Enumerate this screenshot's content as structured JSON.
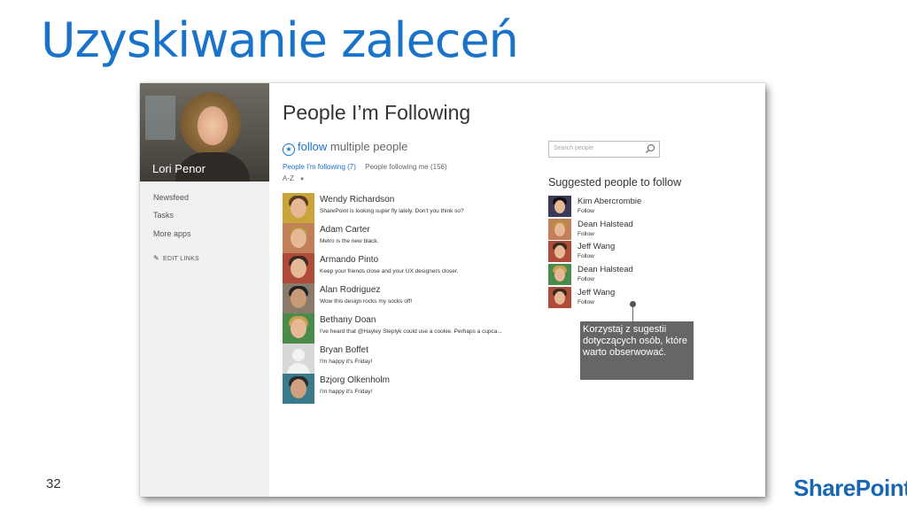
{
  "slide": {
    "title": "Uzyskiwanie zaleceń",
    "page_number": "32",
    "brand": "SharePoint"
  },
  "profile": {
    "name": "Lori Penor"
  },
  "nav": {
    "items": [
      "Newsfeed",
      "Tasks",
      "More apps"
    ],
    "edit_links": "EDIT LINKS"
  },
  "main": {
    "heading": "People I’m Following",
    "follow_word": "follow",
    "follow_rest": " multiple people",
    "tabs": [
      {
        "label": "People I'm following (7)",
        "active": true
      },
      {
        "label": "People following me (156)",
        "active": false
      }
    ],
    "sort_label": "A-Z",
    "people": [
      {
        "name": "Wendy Richardson",
        "status": "SharePoint is looking super fly lately.  Don't you think so?"
      },
      {
        "name": "Adam Carter",
        "status": "Metro is the new black."
      },
      {
        "name": "Armando Pinto",
        "status": "Keep your friends close and your UX designers closer."
      },
      {
        "name": "Alan Rodriguez",
        "status": "Wow this design rocks my socks off!"
      },
      {
        "name": "Bethany Doan",
        "status": "I've heard that @Hayley Steplyk could use a cookie.  Perhaps a cupca..."
      },
      {
        "name": "Bryan Boffet",
        "status": "I'm happy it's Friday!"
      },
      {
        "name": "Bzjorg Olkenholm",
        "status": "I'm happy it's Friday!"
      }
    ]
  },
  "search": {
    "placeholder": "Search people"
  },
  "suggested": {
    "heading": "Suggested people to follow",
    "people": [
      {
        "name": "Kim Abercrombie",
        "action": "Follow"
      },
      {
        "name": "Dean Halstead",
        "action": "Follow"
      },
      {
        "name": "Jeff Wang",
        "action": "Follow"
      },
      {
        "name": "Dean Halstead",
        "action": "Follow"
      },
      {
        "name": "Jeff Wang",
        "action": "Follow"
      }
    ]
  },
  "callout": {
    "text": "Korzystaj z sugestii dotyczących osób, które warto obserwować."
  },
  "colors": {
    "accent": "#1a73c8",
    "callout_bg": "#666666",
    "left_pane_bg": "#f1f1f1"
  }
}
